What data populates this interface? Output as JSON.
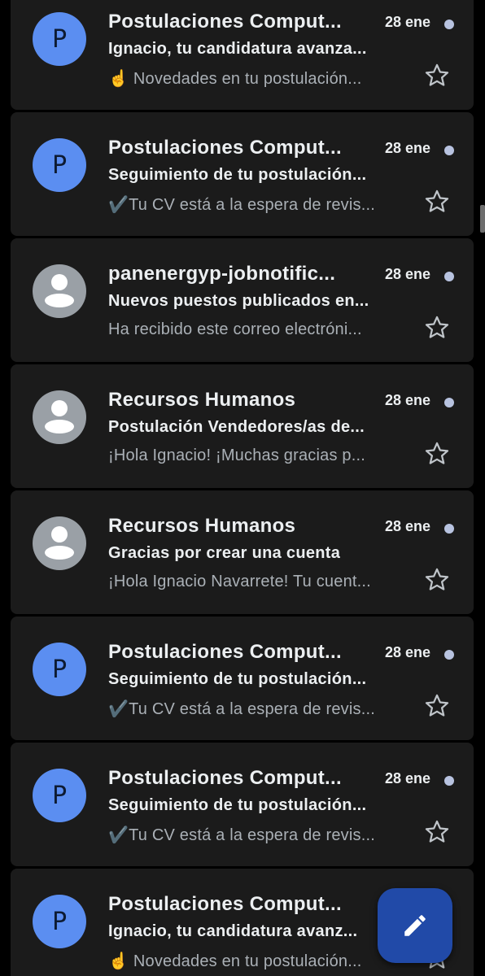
{
  "colors": {
    "background": "#000000",
    "card": "#1b1b1b",
    "avatar_blue": "#5b8ef1",
    "avatar_gray": "#9aa0a6",
    "unread_dot": "#b8c3e0",
    "fab": "#214aa8"
  },
  "emails": [
    {
      "avatar_type": "letter",
      "avatar_letter": "P",
      "sender": "Postulaciones Comput...",
      "date": "28 ene",
      "subject": "Ignacio, tu candidatura avanza...",
      "snippet": "☝️ Novedades en tu postulación...",
      "unread": true
    },
    {
      "avatar_type": "letter",
      "avatar_letter": "P",
      "sender": "Postulaciones Comput...",
      "date": "28 ene",
      "subject": "Seguimiento de tu postulación...",
      "snippet": "✔️Tu CV está a la espera de revis...",
      "unread": true
    },
    {
      "avatar_type": "person",
      "avatar_letter": "",
      "sender": "panenergyp-jobnotific...",
      "date": "28 ene",
      "subject": "Nuevos puestos publicados en...",
      "snippet": "Ha recibido este correo electróni...",
      "unread": true
    },
    {
      "avatar_type": "person",
      "avatar_letter": "",
      "sender": "Recursos Humanos",
      "date": "28 ene",
      "subject": "Postulación Vendedores/as de...",
      "snippet": "¡Hola Ignacio! ¡Muchas gracias p...",
      "unread": true
    },
    {
      "avatar_type": "person",
      "avatar_letter": "",
      "sender": "Recursos Humanos",
      "date": "28 ene",
      "subject": "Gracias por crear una cuenta",
      "snippet": "¡Hola Ignacio Navarrete! Tu cuent...",
      "unread": true
    },
    {
      "avatar_type": "letter",
      "avatar_letter": "P",
      "sender": "Postulaciones Comput...",
      "date": "28 ene",
      "subject": "Seguimiento de tu postulación...",
      "snippet": "✔️Tu CV está a la espera de revis...",
      "unread": true
    },
    {
      "avatar_type": "letter",
      "avatar_letter": "P",
      "sender": "Postulaciones Comput...",
      "date": "28 ene",
      "subject": "Seguimiento de tu postulación...",
      "snippet": "✔️Tu CV está a la espera de revis...",
      "unread": true
    },
    {
      "avatar_type": "letter",
      "avatar_letter": "P",
      "sender": "Postulaciones Comput...",
      "date": "",
      "subject": "Ignacio, tu candidatura avanz...",
      "snippet": "☝️ Novedades en tu postulación...",
      "unread": false
    }
  ],
  "icons": {
    "star": "star-outline-icon",
    "compose": "pencil-icon",
    "person": "person-icon"
  }
}
